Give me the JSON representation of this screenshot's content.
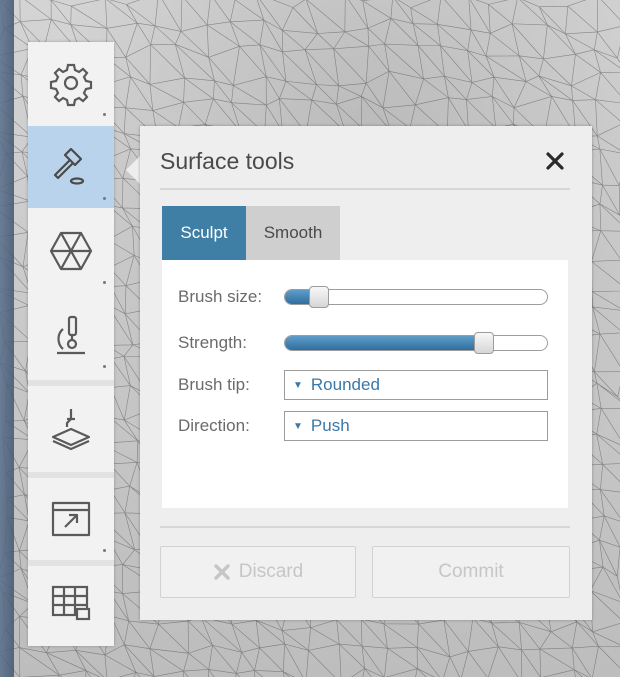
{
  "panel": {
    "title": "Surface tools",
    "close_glyph": "✕",
    "tabs": [
      {
        "label": "Sculpt",
        "active": true
      },
      {
        "label": "Smooth",
        "active": false
      }
    ],
    "fields": {
      "brush_size": {
        "label": "Brush size:",
        "value_fraction": 0.1
      },
      "strength": {
        "label": "Strength:",
        "value_fraction": 0.78
      },
      "brush_tip": {
        "label": "Brush tip:",
        "selected": "Rounded"
      },
      "direction": {
        "label": "Direction:",
        "selected": "Push"
      }
    },
    "buttons": {
      "discard": {
        "label": "Discard",
        "icon": "x-icon",
        "enabled": false
      },
      "commit": {
        "label": "Commit",
        "enabled": false
      }
    }
  },
  "toolbar": {
    "tools": [
      {
        "icon": "gear-icon",
        "active": false
      },
      {
        "icon": "hammer-icon",
        "active": true
      },
      {
        "icon": "mesh-hexagon-icon",
        "active": false
      },
      {
        "icon": "microscope-icon",
        "active": false
      },
      {
        "icon": "print-plate-icon",
        "active": false
      },
      {
        "icon": "export-window-icon",
        "active": false
      },
      {
        "icon": "table-grid-icon",
        "active": false
      }
    ]
  },
  "colors": {
    "accent": "#3f7fa6",
    "active_tool_bg": "#b9d3ec",
    "select_text": "#3a78a8"
  }
}
